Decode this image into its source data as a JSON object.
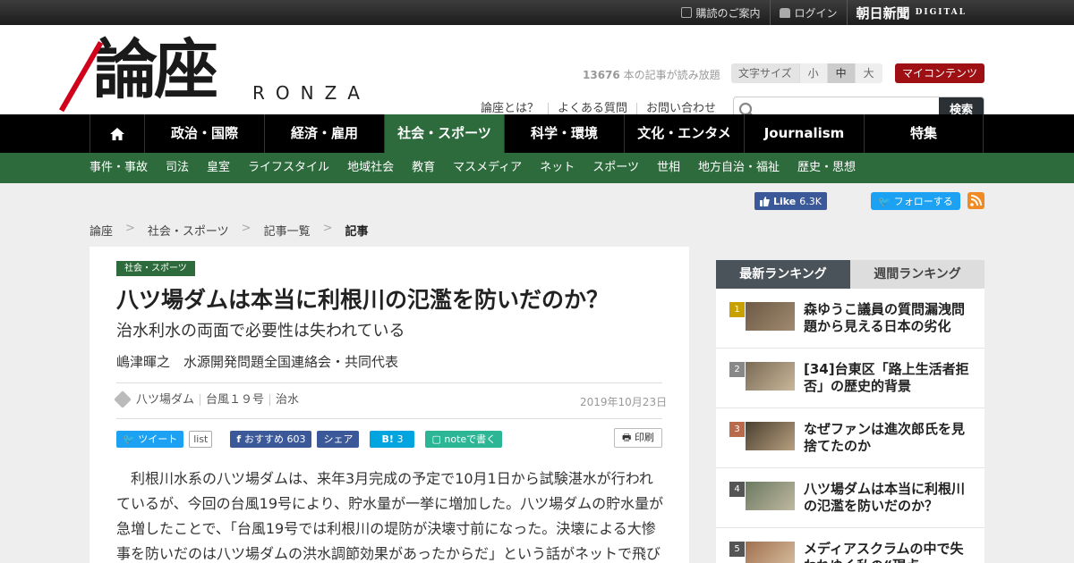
{
  "topbar": {
    "guide": "購読のご案内",
    "login": "ログイン",
    "asahi_logo": "朝日新聞",
    "asahi_digital": "DIGITAL"
  },
  "header": {
    "logo_kanji": "論座",
    "logo_latin": "RONZA",
    "counter_number": "13676",
    "counter_text": " 本の記事が読み放題",
    "fontsize_label": "文字サイズ",
    "fontsize_options": [
      "小",
      "中",
      "大"
    ],
    "fontsize_selected": "中",
    "mycontent": "マイコンテンツ",
    "links": [
      "論座とは？",
      "よくある質問",
      "お問い合わせ"
    ],
    "search_button": "検索",
    "search_placeholder": ""
  },
  "nav": {
    "items": [
      "政治・国際",
      "経済・雇用",
      "社会・スポーツ",
      "科学・環境",
      "文化・エンタメ",
      "Journalism",
      "特集"
    ],
    "active": "社会・スポーツ",
    "home_icon": "home-icon"
  },
  "subnav": {
    "items": [
      "事件・事故",
      "司法",
      "皇室",
      "ライフスタイル",
      "地域社会",
      "教育",
      "マスメディア",
      "ネット",
      "スポーツ",
      "世相",
      "地方自治・福祉",
      "歴史・思想"
    ]
  },
  "social": {
    "fb_like": "Like",
    "fb_count": "6.3K",
    "tw_follow": "フォローする"
  },
  "breadcrumb": {
    "items": [
      "論座",
      "社会・スポーツ",
      "記事一覧",
      "記事"
    ],
    "separator": ">"
  },
  "article": {
    "category": "社会・スポーツ",
    "title": "八ツ場ダムは本当に利根川の氾濫を防いだのか？",
    "subtitle": "治水利水の両面で必要性は失われている",
    "author": "嶋津暉之　水源開発問題全国連絡会・共同代表",
    "tags": [
      "八ツ場ダム",
      "台風１９号",
      "治水"
    ],
    "date": "2019年10月23日",
    "share": {
      "tweet": "ツイート",
      "list": "list",
      "fb_recommend": "おすすめ",
      "fb_count": "603",
      "fb_share": "シェア",
      "hatena": "B!",
      "hatena_count": "3",
      "note": "noteで書く",
      "print": "印刷"
    },
    "body": "利根川水系の八ツ場ダムは、来年3月完成の予定で10月1日から試験湛水が行われているが、今回の台風19号により、貯水量が一挙に増加した。八ツ場ダムの貯水量が急増したことで、「台風19号では利根川の堤防が決壊寸前になった。決壊による大惨事を防いだのは八ツ場ダムの洪水調節効果があったからだ」という話がネットで飛び"
  },
  "ranking": {
    "tab_latest": "最新ランキング",
    "tab_weekly": "週間ランキング",
    "items": [
      {
        "rank": "1",
        "title": "森ゆうこ議員の質問漏洩問題から見える日本の劣化",
        "color": "#c8a000"
      },
      {
        "rank": "2",
        "title": "[34]台東区「路上生活者拒否」の歴史的背景",
        "color": "#888888"
      },
      {
        "rank": "3",
        "title": "なぜファンは進次郎氏を見捨てたのか",
        "color": "#b86a4a"
      },
      {
        "rank": "4",
        "title": "八ツ場ダムは本当に利根川の氾濫を防いだのか？",
        "color": "#555555"
      },
      {
        "rank": "5",
        "title": "メディアスクラムの中で失われゆく私の“現点",
        "color": "#555555"
      }
    ]
  }
}
